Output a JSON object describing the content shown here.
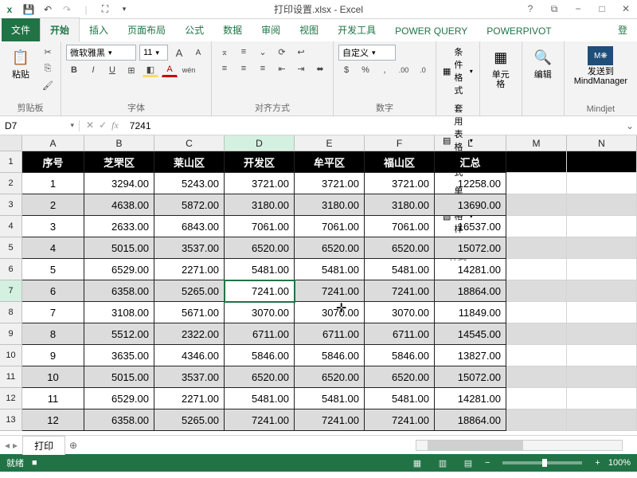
{
  "title": "打印设置.xlsx - Excel",
  "tabs": {
    "file": "文件",
    "home": "开始",
    "insert": "插入",
    "layout": "页面布局",
    "formulas": "公式",
    "data": "数据",
    "review": "审阅",
    "view": "视图",
    "dev": "开发工具",
    "pq": "POWER QUERY",
    "pp": "POWERPIVOT",
    "account": "登"
  },
  "ribbon": {
    "clipboard": {
      "paste": "粘贴",
      "label": "剪贴板"
    },
    "font": {
      "name": "微软雅黑",
      "size": "11",
      "label": "字体",
      "bold": "B",
      "italic": "I",
      "underline": "U",
      "a1": "A",
      "a2": "A",
      "wen": "wén"
    },
    "align": {
      "label": "对齐方式"
    },
    "number": {
      "format": "自定义",
      "label": "数字",
      "pct": "%",
      "comma": ",",
      "dec1": "←.0",
      "dec2": ".00→"
    },
    "styles": {
      "cond": "条件格式",
      "table": "套用表格格式",
      "cell": "单元格样式",
      "label": "样式"
    },
    "cells": {
      "label": "单元格"
    },
    "editing": {
      "label": "编辑"
    },
    "mind": {
      "btn": "发送到\nMindManager",
      "label": "Mindjet"
    }
  },
  "namebox": "D7",
  "formula": "7241",
  "columns": [
    "A",
    "B",
    "C",
    "D",
    "E",
    "F",
    "L",
    "M",
    "N"
  ],
  "headerRow": [
    "序号",
    "芝罘区",
    "莱山区",
    "开发区",
    "牟平区",
    "福山区",
    "汇总"
  ],
  "rows": [
    {
      "n": 1,
      "alt": false,
      "c": [
        "1",
        "3294.00",
        "5243.00",
        "3721.00",
        "3721.00",
        "3721.00",
        "12258.00"
      ]
    },
    {
      "n": 2,
      "alt": true,
      "c": [
        "2",
        "4638.00",
        "5872.00",
        "3180.00",
        "3180.00",
        "3180.00",
        "13690.00"
      ]
    },
    {
      "n": 3,
      "alt": false,
      "c": [
        "3",
        "2633.00",
        "6843.00",
        "7061.00",
        "7061.00",
        "7061.00",
        "16537.00"
      ]
    },
    {
      "n": 4,
      "alt": true,
      "c": [
        "4",
        "5015.00",
        "3537.00",
        "6520.00",
        "6520.00",
        "6520.00",
        "15072.00"
      ]
    },
    {
      "n": 5,
      "alt": false,
      "c": [
        "5",
        "6529.00",
        "2271.00",
        "5481.00",
        "5481.00",
        "5481.00",
        "14281.00"
      ]
    },
    {
      "n": 6,
      "alt": true,
      "c": [
        "6",
        "6358.00",
        "5265.00",
        "7241.00",
        "7241.00",
        "7241.00",
        "18864.00"
      ]
    },
    {
      "n": 7,
      "alt": false,
      "c": [
        "7",
        "3108.00",
        "5671.00",
        "3070.00",
        "3070.00",
        "3070.00",
        "11849.00"
      ]
    },
    {
      "n": 8,
      "alt": true,
      "c": [
        "8",
        "5512.00",
        "2322.00",
        "6711.00",
        "6711.00",
        "6711.00",
        "14545.00"
      ]
    },
    {
      "n": 9,
      "alt": false,
      "c": [
        "9",
        "3635.00",
        "4346.00",
        "5846.00",
        "5846.00",
        "5846.00",
        "13827.00"
      ]
    },
    {
      "n": 10,
      "alt": true,
      "c": [
        "10",
        "5015.00",
        "3537.00",
        "6520.00",
        "6520.00",
        "6520.00",
        "15072.00"
      ]
    },
    {
      "n": 11,
      "alt": false,
      "c": [
        "11",
        "6529.00",
        "2271.00",
        "5481.00",
        "5481.00",
        "5481.00",
        "14281.00"
      ]
    },
    {
      "n": 12,
      "alt": true,
      "c": [
        "12",
        "6358.00",
        "5265.00",
        "7241.00",
        "7241.00",
        "7241.00",
        "18864.00"
      ]
    }
  ],
  "activeCell": {
    "row": 7,
    "col": 3
  },
  "sheet": "打印",
  "status": {
    "ready": "就绪",
    "rec": "■",
    "zoom": "100%",
    "minus": "−",
    "plus": "+"
  }
}
